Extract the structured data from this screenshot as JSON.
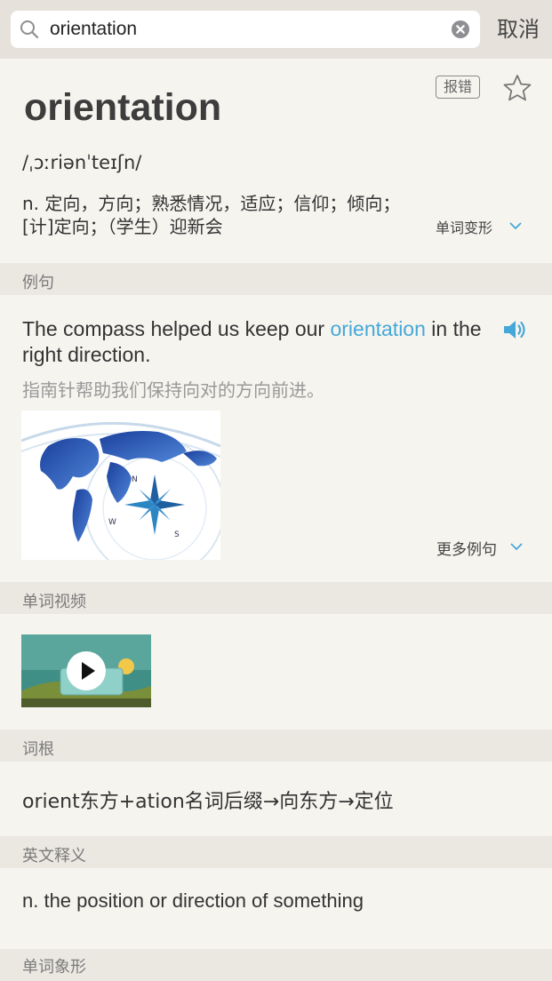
{
  "search": {
    "query": "orientation",
    "cancel_label": "取消"
  },
  "entry": {
    "word": "orientation",
    "report_label": "报错",
    "phonetic": "/ˌɔːriənˈteɪʃn/",
    "definition": "n. 定向，方向；熟悉情况，适应；信仰；倾向；[计]定向；（学生）迎新会",
    "inflection_label": "单词变形"
  },
  "sections": {
    "examples": {
      "header": "例句",
      "sentence_before": "The compass helped us keep our ",
      "sentence_highlight": "orientation",
      "sentence_after": " in the right direction.",
      "translation": "指南针帮助我们保持向对的方向前进。",
      "more_label": "更多例句"
    },
    "video": {
      "header": "单词视频"
    },
    "root": {
      "header": "词根",
      "text": "orient东方+ation名词后缀→向东方→定位"
    },
    "english_def": {
      "header": "英文释义",
      "text": "n. the position or direction of something"
    },
    "next": {
      "header": "单词象形"
    }
  },
  "colors": {
    "accent": "#45a8d8",
    "background": "#f6f4ef",
    "section_header": "#ebe8e2"
  },
  "icons": [
    "search-icon",
    "clear-icon",
    "star-icon",
    "speaker-icon",
    "chevron-down-icon",
    "play-icon"
  ]
}
